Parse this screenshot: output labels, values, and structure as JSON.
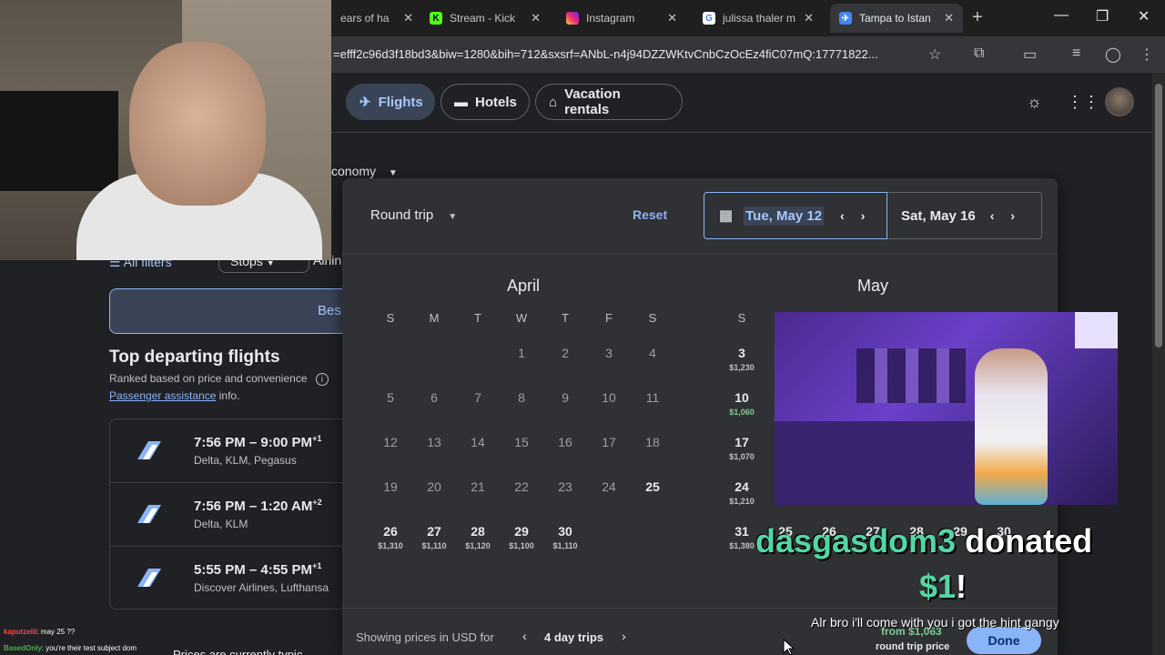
{
  "browser": {
    "tabs": [
      {
        "title": "ears of ha",
        "icon": "generic-favicon",
        "active": false
      },
      {
        "title": "Stream - Kick",
        "icon": "kick-favicon",
        "active": false
      },
      {
        "title": "Instagram",
        "icon": "instagram-favicon",
        "active": false
      },
      {
        "title": "julissa thaler m",
        "icon": "google-favicon",
        "active": false
      },
      {
        "title": "Tampa to Istan",
        "icon": "google-flights-favicon",
        "active": true
      }
    ],
    "url": "=efff2c96d3f18bd3&biw=1280&bih=712&sxsrf=ANbL-n4j94DZZWKtvCnbCzOcEz4fiC07mQ:17771822..."
  },
  "header": {
    "nav": [
      {
        "label": "Flights",
        "icon": "airplane-icon",
        "active": true
      },
      {
        "label": "Hotels",
        "icon": "bed-icon",
        "active": false
      },
      {
        "label": "Vacation rentals",
        "icon": "home-icon",
        "active": false
      }
    ]
  },
  "search": {
    "cabin": "conomy"
  },
  "results": {
    "filters_label": "All filters",
    "stops_label": "Stops",
    "airlines_label": "Airlin",
    "best_tab": "Bes",
    "section_title": "Top departing flights",
    "ranked_note": "Ranked based on price and convenience",
    "passenger_link": "Passenger assistance",
    "passenger_suffix": "info.",
    "flights": [
      {
        "time": "7:56 PM – 9:00 PM",
        "offset": "+1",
        "airlines": "Delta, KLM, Pegasus"
      },
      {
        "time": "7:56 PM – 1:20 AM",
        "offset": "+2",
        "airlines": "Delta, KLM"
      },
      {
        "time": "5:55 PM – 4:55 PM",
        "offset": "+1",
        "airlines": "Discover Airlines, Lufthansa"
      }
    ],
    "prices_note": "Prices are currently typic"
  },
  "datepicker": {
    "trip_type": "Round trip",
    "reset_label": "Reset",
    "departure": "Tue, May 12",
    "return": "Sat, May 16",
    "weekdays": [
      "S",
      "M",
      "T",
      "W",
      "T",
      "F",
      "S"
    ],
    "april": {
      "title": "April",
      "days": [
        {
          "d": "1",
          "col": 3,
          "row": 0
        },
        {
          "d": "2",
          "col": 4,
          "row": 0
        },
        {
          "d": "3",
          "col": 5,
          "row": 0
        },
        {
          "d": "4",
          "col": 6,
          "row": 0
        },
        {
          "d": "5",
          "col": 0,
          "row": 1
        },
        {
          "d": "6",
          "col": 1,
          "row": 1
        },
        {
          "d": "7",
          "col": 2,
          "row": 1
        },
        {
          "d": "8",
          "col": 3,
          "row": 1
        },
        {
          "d": "9",
          "col": 4,
          "row": 1
        },
        {
          "d": "10",
          "col": 5,
          "row": 1
        },
        {
          "d": "11",
          "col": 6,
          "row": 1
        },
        {
          "d": "12",
          "col": 0,
          "row": 2
        },
        {
          "d": "13",
          "col": 1,
          "row": 2
        },
        {
          "d": "14",
          "col": 2,
          "row": 2
        },
        {
          "d": "15",
          "col": 3,
          "row": 2
        },
        {
          "d": "16",
          "col": 4,
          "row": 2
        },
        {
          "d": "17",
          "col": 5,
          "row": 2
        },
        {
          "d": "18",
          "col": 6,
          "row": 2
        },
        {
          "d": "19",
          "col": 0,
          "row": 3
        },
        {
          "d": "20",
          "col": 1,
          "row": 3
        },
        {
          "d": "21",
          "col": 2,
          "row": 3
        },
        {
          "d": "22",
          "col": 3,
          "row": 3
        },
        {
          "d": "23",
          "col": 4,
          "row": 3
        },
        {
          "d": "24",
          "col": 5,
          "row": 3
        },
        {
          "d": "25",
          "col": 6,
          "row": 3,
          "bold": true
        },
        {
          "d": "26",
          "col": 0,
          "row": 4,
          "price": "$1,310"
        },
        {
          "d": "27",
          "col": 1,
          "row": 4,
          "price": "$1,110"
        },
        {
          "d": "28",
          "col": 2,
          "row": 4,
          "price": "$1,120"
        },
        {
          "d": "29",
          "col": 3,
          "row": 4,
          "price": "$1,100"
        },
        {
          "d": "30",
          "col": 4,
          "row": 4,
          "price": "$1,110"
        }
      ]
    },
    "may": {
      "title": "May",
      "weekday_visible": "S",
      "days": [
        {
          "d": "3",
          "row": 1,
          "price": "$1,230"
        },
        {
          "d": "10",
          "row": 2,
          "price": "$1,060",
          "low": true
        },
        {
          "d": "17",
          "row": 3,
          "price": "$1,070"
        },
        {
          "d": "24",
          "row": 4,
          "price": "$1,210"
        },
        {
          "d": "31",
          "row": 5,
          "price": "$1,380"
        }
      ],
      "partial_row": [
        "25",
        "26",
        "27",
        "28",
        "29",
        "30"
      ]
    },
    "footer": {
      "showing": "Showing prices in USD for",
      "trip_length": "4 day trips",
      "from_price": "from $1,063",
      "round_trip_label": "round trip price",
      "done_label": "Done"
    }
  },
  "stream": {
    "chat": [
      {
        "user": "kaputzelli",
        "text": ": may 25 ??"
      },
      {
        "user": "BasedOnly",
        "text": ": you're their test subject dom"
      }
    ],
    "donation_name": "dasgasdom3",
    "donation_verb": "donated",
    "donation_amount": "$1",
    "donation_message": "Alr bro i'll come with you i got the hint gangy"
  }
}
